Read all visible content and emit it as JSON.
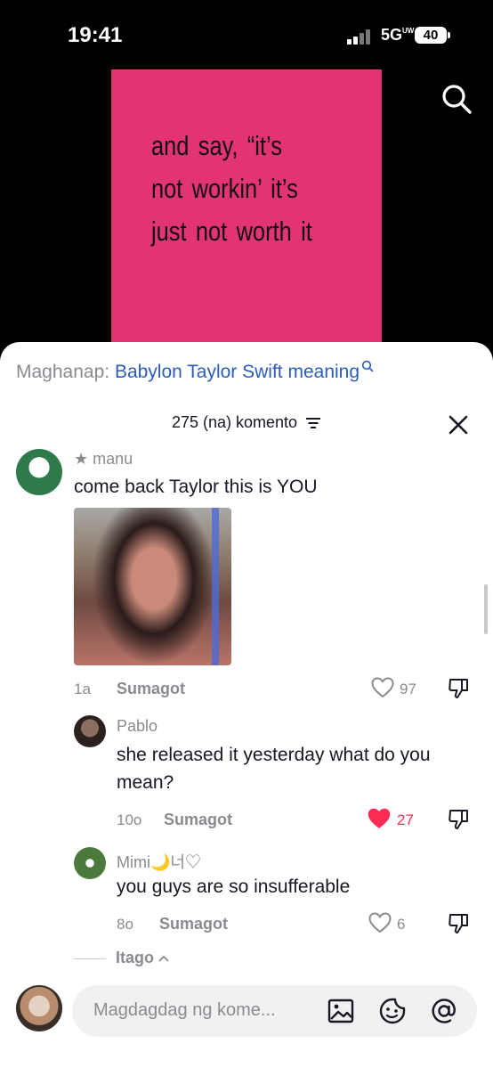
{
  "status_bar": {
    "time": "19:41",
    "network": "5G",
    "network_sub": "UW",
    "battery": "40"
  },
  "video": {
    "caption": "and say, “it’s not workin’ it’s just not worth it"
  },
  "search_suggestion": {
    "prefix": "Maghanap:",
    "query": "Babylon Taylor Swift meaning"
  },
  "comments_header": {
    "count_label": "275 (na) komento"
  },
  "comments": [
    {
      "username": "★ manu",
      "text": "come back Taylor this is YOU",
      "age": "1a",
      "reply_label": "Sumagot",
      "likes": "97",
      "liked": false
    },
    {
      "username": "Pablo",
      "text": "she released it yesterday what do you mean?",
      "age": "10o",
      "reply_label": "Sumagot",
      "likes": "27",
      "liked": true
    },
    {
      "username": "Mimi🌙너♡",
      "text": "you guys are so insufferable",
      "age": "8o",
      "reply_label": "Sumagot",
      "likes": "6",
      "liked": false
    }
  ],
  "hide_replies": "Itago",
  "composer": {
    "placeholder": "Magdagdag ng kome..."
  },
  "colors": {
    "video_bg": "#e23373",
    "liked_heart": "#fe2c55",
    "link_blue": "#2b5db8",
    "muted": "#8a8b91"
  }
}
